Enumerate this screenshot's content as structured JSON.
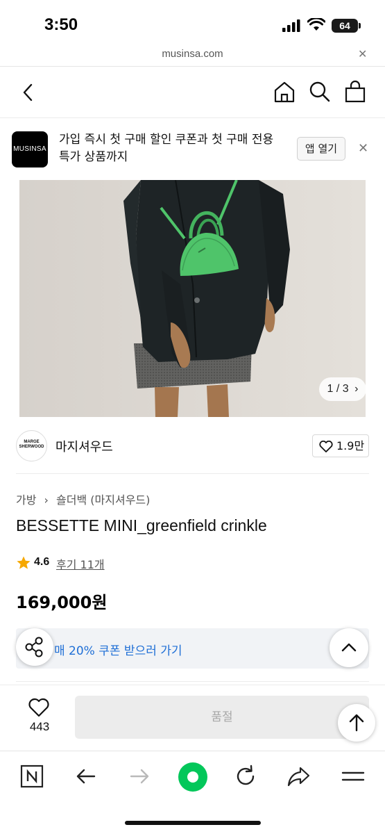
{
  "status_bar": {
    "time": "3:50",
    "battery": "64"
  },
  "browser": {
    "url": "musinsa.com"
  },
  "app_banner": {
    "logo_text": "MUSINSA",
    "message": "가입 즉시 첫 구매 할인 쿠폰과 첫 구매 전용 특가 상품까지",
    "open_app_label": "앱 열기"
  },
  "gallery": {
    "counter": "1 / 3"
  },
  "brand": {
    "logo_text": "MARGE SHERWOOD",
    "name": "마지셔우드",
    "likes": "1.9만"
  },
  "product": {
    "breadcrumb": [
      "가방",
      "숄더백 (마지셔우드)"
    ],
    "title": "BESSETTE MINI_greenfield crinkle",
    "rating": "4.6",
    "reviews": "후기 11개",
    "price": "169,000원"
  },
  "coupon": {
    "text": "매 20% 쿠폰 받으러 가기"
  },
  "purchase_bar": {
    "wish_count": "443",
    "button_label": "품절"
  },
  "colors": {
    "accent_blue": "#1f6fd6",
    "naver_green": "#03c75a",
    "bag_green": "#4fc46a",
    "star": "#f6a800"
  },
  "icons": [
    "back-icon",
    "home-icon",
    "search-icon",
    "cart-icon",
    "close-icon",
    "chevron-right-icon",
    "heart-icon",
    "star-icon",
    "share-icon",
    "chevron-up-icon",
    "arrow-up-icon",
    "naver-icon",
    "arrow-left-icon",
    "arrow-right-icon",
    "green-circle-icon",
    "refresh-icon",
    "forward-share-icon",
    "menu-icon"
  ]
}
